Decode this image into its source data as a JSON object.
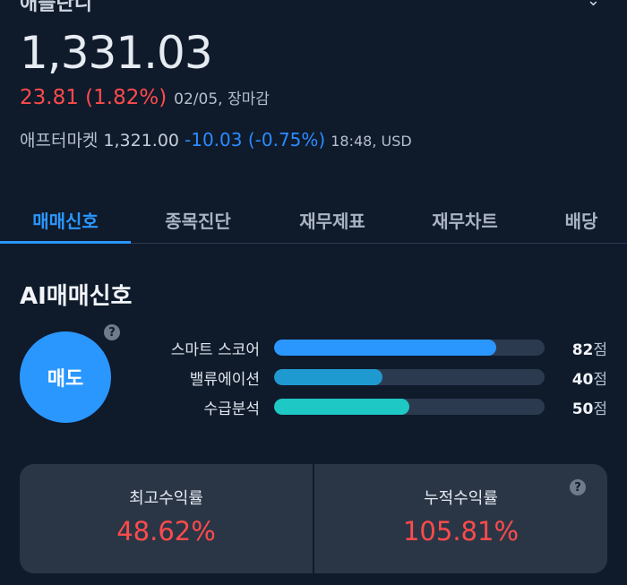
{
  "header": {
    "price": "1,331.03",
    "change_value": "23.81 (1.82%)",
    "change_meta": "02/05, 장마감",
    "aftermarket_label": "애프터마켓",
    "aftermarket_price": "1,321.00",
    "aftermarket_change": "-10.03 (-0.75%)",
    "aftermarket_meta": "18:48, USD"
  },
  "tabs": [
    {
      "label": "매매신호",
      "active": true
    },
    {
      "label": "종목진단",
      "active": false
    },
    {
      "label": "재무제표",
      "active": false
    },
    {
      "label": "재무차트",
      "active": false
    },
    {
      "label": "배당",
      "active": false
    }
  ],
  "ai_signal": {
    "title": "AI매매신호",
    "signal_label": "매도",
    "help_glyph": "?",
    "scores": [
      {
        "label": "스마트 스코어",
        "value": 82,
        "unit": "점",
        "color": "#2a97ff"
      },
      {
        "label": "밸류에이션",
        "value": 40,
        "unit": "점",
        "color": "#1f9ad0"
      },
      {
        "label": "수급분석",
        "value": 50,
        "unit": "점",
        "color": "#1ec8c4"
      }
    ]
  },
  "returns": {
    "max_label": "최고수익률",
    "max_value": "48.62%",
    "cum_label": "누적수익률",
    "cum_value": "105.81%",
    "help_glyph": "?"
  },
  "colors": {
    "background": "#0f1a2b",
    "accent": "#2a97ff",
    "up": "#ff4b4b",
    "down": "#2a8cff"
  }
}
